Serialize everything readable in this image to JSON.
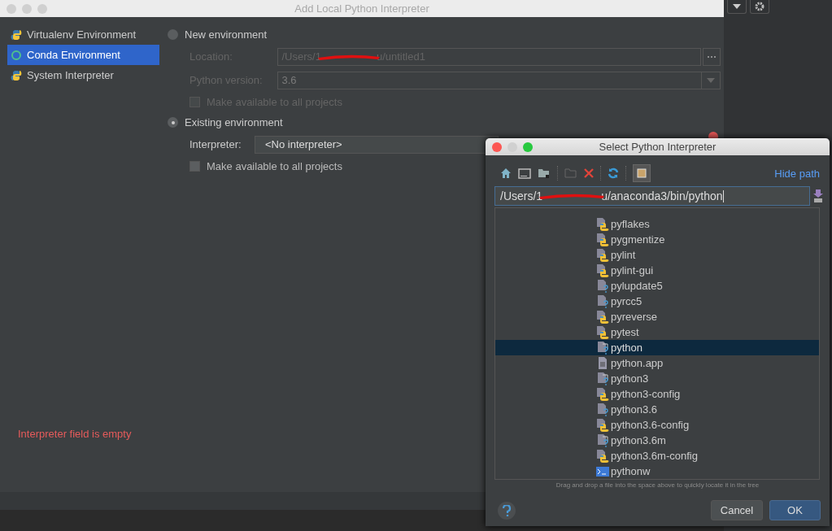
{
  "window": {
    "title": "Add Local Python Interpreter"
  },
  "sidebar": {
    "items": [
      {
        "label": "Virtualenv Environment",
        "kind": "virtualenv",
        "selected": false
      },
      {
        "label": "Conda Environment",
        "kind": "conda",
        "selected": true
      },
      {
        "label": "System Interpreter",
        "kind": "system",
        "selected": false
      }
    ]
  },
  "new_environment": {
    "label": "New environment",
    "selected": false,
    "disabled": true,
    "location": {
      "label": "Location:",
      "value_start": "/Users/1",
      "value_end": "u/untitled1"
    },
    "python_version": {
      "label": "Python version:",
      "value": "3.6"
    },
    "make_available": {
      "label": "Make available to all projects",
      "checked": false
    }
  },
  "existing_environment": {
    "label": "Existing environment",
    "selected": true,
    "interpreter": {
      "label": "Interpreter:",
      "value": "<No interpreter>"
    },
    "make_available": {
      "label": "Make available to all projects",
      "checked": false
    }
  },
  "error": "Interpreter field is empty",
  "file_dialog": {
    "title": "Select Python Interpreter",
    "hide_path": "Hide path",
    "path_start": "/Users/1",
    "path_end": "u/anaconda3/bin/python",
    "files": [
      {
        "name": "pyflakes",
        "kind": "python",
        "selected": false
      },
      {
        "name": "pygmentize",
        "kind": "python",
        "selected": false
      },
      {
        "name": "pylint",
        "kind": "python",
        "selected": false
      },
      {
        "name": "pylint-gui",
        "kind": "python",
        "selected": false
      },
      {
        "name": "pylupdate5",
        "kind": "unknown",
        "selected": false
      },
      {
        "name": "pyrcc5",
        "kind": "unknown",
        "selected": false
      },
      {
        "name": "pyreverse",
        "kind": "python",
        "selected": false
      },
      {
        "name": "pytest",
        "kind": "python",
        "selected": false
      },
      {
        "name": "python",
        "kind": "link",
        "selected": true
      },
      {
        "name": "python.app",
        "kind": "text",
        "selected": false
      },
      {
        "name": "python3",
        "kind": "link",
        "selected": false
      },
      {
        "name": "python3-config",
        "kind": "python",
        "selected": false
      },
      {
        "name": "python3.6",
        "kind": "unknown",
        "selected": false
      },
      {
        "name": "python3.6-config",
        "kind": "python",
        "selected": false
      },
      {
        "name": "python3.6m",
        "kind": "link",
        "selected": false
      },
      {
        "name": "python3.6m-config",
        "kind": "python",
        "selected": false
      },
      {
        "name": "pythonw",
        "kind": "terminal",
        "selected": false
      }
    ],
    "hint": "Drag and drop a file into the space above to quickly locate it in the tree",
    "buttons": [
      {
        "label": "Cancel",
        "kind": "secondary"
      },
      {
        "label": "OK",
        "kind": "primary"
      }
    ]
  }
}
